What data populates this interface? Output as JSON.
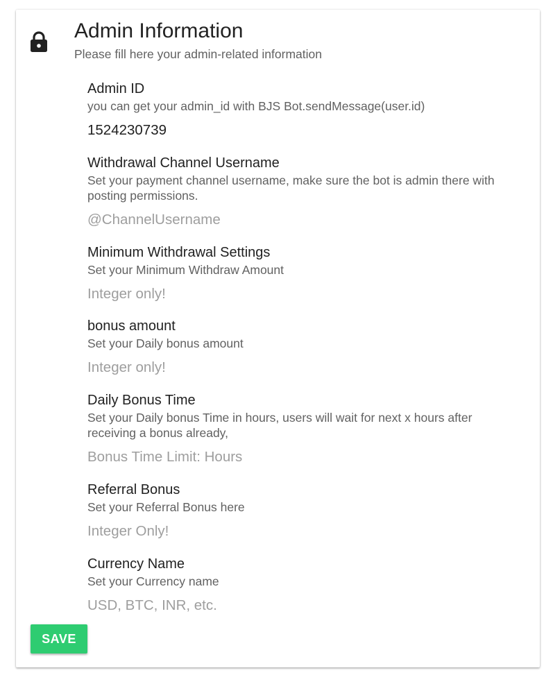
{
  "header": {
    "title": "Admin Information",
    "subtitle": "Please fill here your admin-related information",
    "icon": "lock-icon"
  },
  "fields": [
    {
      "label": "Admin ID",
      "description": "you can get your admin_id with BJS Bot.sendMessage(user.id)",
      "value": "1524230739",
      "placeholder": ""
    },
    {
      "label": "Withdrawal Channel Username",
      "description": "Set your payment channel username, make sure the bot is admin there with posting permissions.",
      "value": "",
      "placeholder": "@ChannelUsername"
    },
    {
      "label": "Minimum Withdrawal Settings",
      "description": "Set your Minimum Withdraw Amount",
      "value": "",
      "placeholder": "Integer only!"
    },
    {
      "label": "bonus amount",
      "description": "Set your Daily bonus amount",
      "value": "",
      "placeholder": "Integer only!"
    },
    {
      "label": "Daily Bonus Time",
      "description": "Set your Daily bonus Time in hours, users will wait for next x hours after receiving a bonus already,",
      "value": "",
      "placeholder": "Bonus Time Limit: Hours"
    },
    {
      "label": "Referral Bonus",
      "description": "Set your Referral Bonus here",
      "value": "",
      "placeholder": "Integer Only!"
    },
    {
      "label": "Currency Name",
      "description": "Set your Currency name",
      "value": "",
      "placeholder": "USD, BTC, INR, etc."
    }
  ],
  "actions": {
    "save_label": "SAVE"
  },
  "colors": {
    "accent": "#2ecc71",
    "text_primary": "#212121",
    "text_secondary": "#616161",
    "placeholder": "#9e9e9e"
  }
}
